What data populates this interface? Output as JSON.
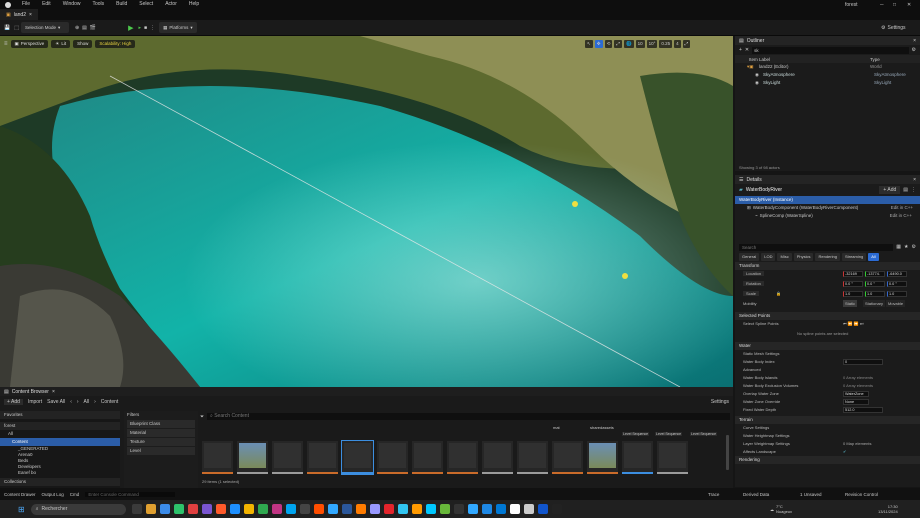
{
  "menu": [
    "File",
    "Edit",
    "Window",
    "Tools",
    "Build",
    "Select",
    "Actor",
    "Help"
  ],
  "project_name": "forest",
  "document_tab": "land2",
  "toolbar": {
    "mode": "Selection Mode",
    "platforms": "Platforms",
    "settings": "Settings"
  },
  "viewport": {
    "perspective": "Perspective",
    "lit": "Lit",
    "show": "Show",
    "scalability": "Scalability: High",
    "snap_values": [
      "10",
      "10°",
      "0.25",
      "4"
    ]
  },
  "outliner": {
    "title": "Outliner",
    "search_value": "sk",
    "col_label": "Item Label",
    "col_type": "Type",
    "items": [
      {
        "label": "land22 (Editor)",
        "type": "World"
      },
      {
        "label": "SkyAtmosphere",
        "type": "SkyAtmosphere"
      },
      {
        "label": "SkyLight",
        "type": "SkyLight"
      }
    ],
    "status": "Showing 3 of 98 actors"
  },
  "details": {
    "title": "Details",
    "object_name": "WaterBodyRiver",
    "add_label": "+ Add",
    "instance": "WaterBodyRiver (Instance)",
    "components": [
      {
        "label": "WaterBodyComponent (WaterBodyRiverComponent)",
        "action": "Edit in C++"
      },
      {
        "label": "SplineComp (WaterSpline)",
        "action": "Edit in C++"
      }
    ],
    "search_placeholder": "Search",
    "categories": [
      "General",
      "LOD",
      "Misc",
      "Physics",
      "Rendering",
      "Streaming",
      "All"
    ],
    "transform_title": "Transform",
    "location_label": "Location",
    "location": [
      "-32169",
      "-13774.",
      "-6490.0"
    ],
    "rotation_label": "Rotation",
    "rotation": [
      "0.0 °",
      "0.0 °",
      "0.0 °"
    ],
    "scale_label": "Scale",
    "scale": [
      "1.0",
      "1.0",
      "1.0"
    ],
    "mobility_label": "Mobility",
    "mobility": [
      "Static",
      "Stationary",
      "Movable"
    ],
    "selected_points": "Selected Points",
    "select_spline_points": "Select Spline Points",
    "no_points": "No spline points are selected",
    "water_title": "Water",
    "static_mesh_settings": "Static Mesh Settings",
    "water_body_index_label": "Water Body Index",
    "water_body_index": "0",
    "advanced": "Advanced",
    "water_body_islands": "Water Body Islands",
    "islands_value": "0 Array elements",
    "water_body_exclusion": "Water Body Exclusion Volumes",
    "exclusion_value": "0 Array elements",
    "overlap_zone_label": "Overlap Water Zone",
    "overlap_zone": "WaterZone",
    "water_zone_override_label": "Water Zone Override",
    "water_zone_override": "None",
    "fixed_depth_label": "Fixed Water Depth",
    "fixed_depth": "512.0",
    "terrain_title": "Terrain",
    "curve_settings": "Curve Settings",
    "water_heightmap_settings": "Water Heightmap Settings",
    "layer_weightmap_settings": "Layer Weightmap Settings",
    "layer_weightmap_value": "0 Map elements",
    "affects_landscape": "Affects Landscape",
    "rendering_title": "Rendering"
  },
  "content_browser": {
    "tab_label": "Content Browser",
    "add": "+ Add",
    "import": "Import",
    "save_all": "Save All",
    "path_all": "All",
    "path_content": "Content",
    "settings": "Settings",
    "favorites": "Favorites",
    "project": "forest",
    "tree": [
      "All",
      "Content",
      "_GENERATED",
      "Arena0",
      "Beds",
      "Developers",
      "Eanef bo"
    ],
    "collections": "Collections",
    "filters_title": "Filters",
    "filters": [
      "Blueprint Class",
      "Material",
      "Texture",
      "Level"
    ],
    "search_placeholder": "Search Content",
    "item_count": "29 items (1 selected)",
    "top_labels": [
      "mat",
      "sharedassets",
      "Level Sequence",
      "Level Sequence",
      "Level Sequence"
    ],
    "asset_accents": [
      "#c96b2a",
      "#9b9b9b",
      "#9b9b9b",
      "#c96b2a",
      "#3c8ee0",
      "#c96b2a",
      "#c96b2a",
      "#c96b2a",
      "#9b9b9b",
      "#9b9b9b",
      "#c96b2a",
      "#c96b2a",
      "#3c8ee0",
      "#9b9b9b"
    ]
  },
  "status_bar": {
    "content_drawer": "Content Drawer",
    "output_log": "Output Log",
    "cmd": "Cmd",
    "cmd_placeholder": "Enter Console Command",
    "trace": "Trace",
    "derived_data": "Derived Data",
    "unsaved": "1 Unsaved",
    "revision_control": "Revision Control"
  },
  "taskbar": {
    "search_placeholder": "Rechercher",
    "weather_temp": "7°C",
    "weather_desc": "Nuageux",
    "time": "17:30",
    "date": "13/11/2024"
  }
}
